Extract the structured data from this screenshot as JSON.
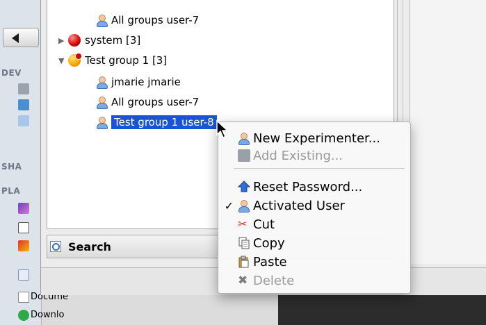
{
  "finder_sidebar": {
    "sections": [
      "DEV",
      "SHA",
      "PLA"
    ],
    "bottom_items": [
      "Docume",
      "Downlo"
    ]
  },
  "tree": {
    "rows": [
      {
        "label": "All groups user-7",
        "type": "user",
        "expanded": null
      },
      {
        "label": "system [3]",
        "type": "group-red",
        "expanded": false
      },
      {
        "label": "Test group 1 [3]",
        "type": "group-orange",
        "expanded": true
      },
      {
        "label": "jmarie jmarie",
        "type": "user",
        "expanded": null
      },
      {
        "label": "All groups user-7",
        "type": "user",
        "expanded": null
      },
      {
        "label": "Test group 1 user-8",
        "type": "user",
        "expanded": null,
        "selected": true
      }
    ]
  },
  "search": {
    "label": "Search"
  },
  "context_menu": {
    "items": [
      {
        "label": "New Experimenter...",
        "icon": "user-icon",
        "enabled": true,
        "checked": false
      },
      {
        "label": "Add Existing...",
        "icon": "add-existing-icon",
        "enabled": false,
        "checked": false
      },
      {
        "label": "Reset Password...",
        "icon": "home-arrow-icon",
        "enabled": true,
        "checked": false
      },
      {
        "label": "Activated User",
        "icon": "user-icon",
        "enabled": true,
        "checked": true
      },
      {
        "label": "Cut",
        "icon": "scissors-icon",
        "enabled": true,
        "checked": false
      },
      {
        "label": "Copy",
        "icon": "copy-icon",
        "enabled": true,
        "checked": false
      },
      {
        "label": "Paste",
        "icon": "paste-icon",
        "enabled": true,
        "checked": false
      },
      {
        "label": "Delete",
        "icon": "delete-icon",
        "enabled": false,
        "checked": false
      }
    ],
    "check_glyph": "✓"
  },
  "colors": {
    "selection": "#1854d6",
    "menu_bg": "#f8f8f8",
    "disabled": "#9a9a9a"
  }
}
